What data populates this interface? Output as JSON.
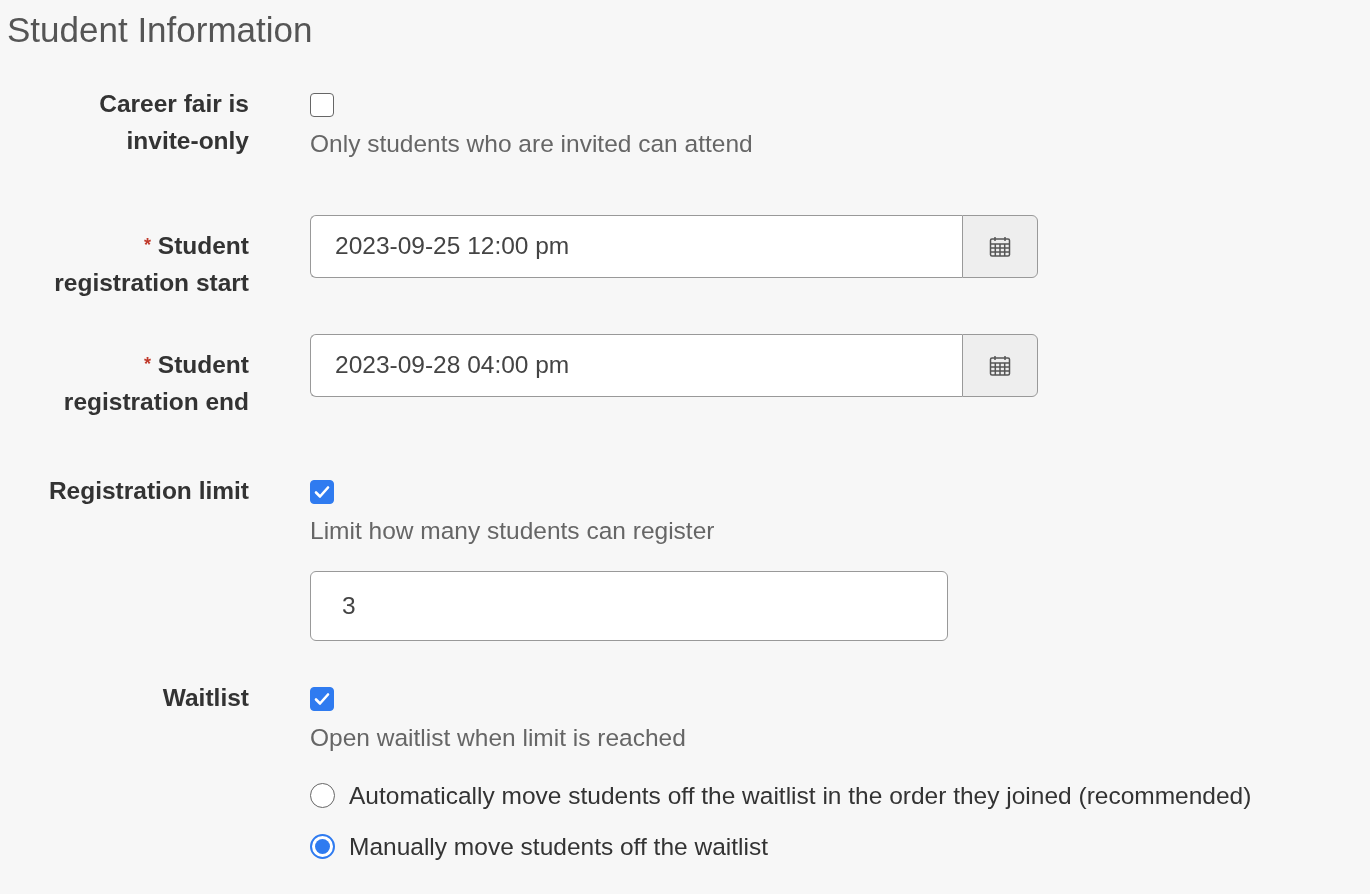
{
  "section_title": "Student Information",
  "fields": [
    {
      "kind": "checkbox",
      "label": "Career fair is invite-only",
      "checked": false,
      "help": "Only students who are invited can attend"
    },
    {
      "kind": "datetime",
      "label": "Student registration start",
      "required_mark": "*",
      "value": "2023-09-25 12:00 pm"
    },
    {
      "kind": "datetime",
      "label": "Student registration end",
      "required_mark": "*",
      "value": "2023-09-28 04:00 pm"
    },
    {
      "kind": "checkbox",
      "label": "Registration limit",
      "checked": true,
      "help": "Limit how many students can register",
      "input_value": "3"
    },
    {
      "kind": "checkbox",
      "label": "Waitlist",
      "checked": true,
      "help": "Open waitlist when limit is reached",
      "options": [
        {
          "label": "Automatically move students off the waitlist in the order they joined (recommended)",
          "selected": false
        },
        {
          "label": "Manually move students off the waitlist",
          "selected": true
        }
      ]
    }
  ]
}
